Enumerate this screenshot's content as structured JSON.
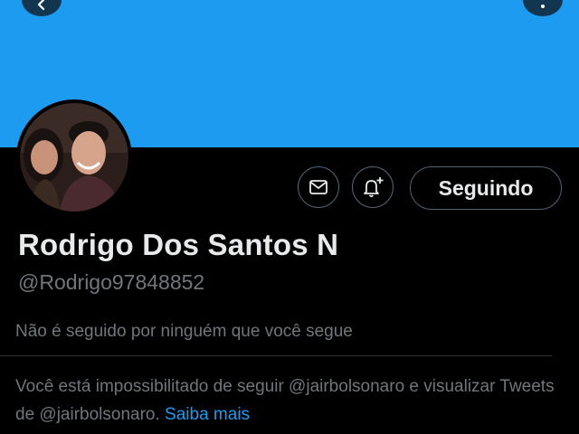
{
  "colors": {
    "banner": "#1d9bf0",
    "background": "#000000",
    "primary_text": "#e7e9ea",
    "secondary_text": "#71767b",
    "link": "#1d9bf0",
    "border": "#536471"
  },
  "header": {
    "back_icon": "chevron-left-icon",
    "more_icon": "more-vertical-icon"
  },
  "profile": {
    "avatar_icon": "profile-photo",
    "name": "Rodrigo Dos Santos N",
    "handle": "@Rodrigo97848852",
    "followed_by_text": "Não é seguido por ninguém que você segue"
  },
  "actions": {
    "message_icon": "envelope-icon",
    "notify_icon": "bell-plus-icon",
    "following_label": "Seguindo"
  },
  "notice": {
    "text": "Você está impossibilitado de seguir @jairbolsonaro e visualizar Tweets de @jairbolsonaro.",
    "link_label": "Saiba mais"
  }
}
